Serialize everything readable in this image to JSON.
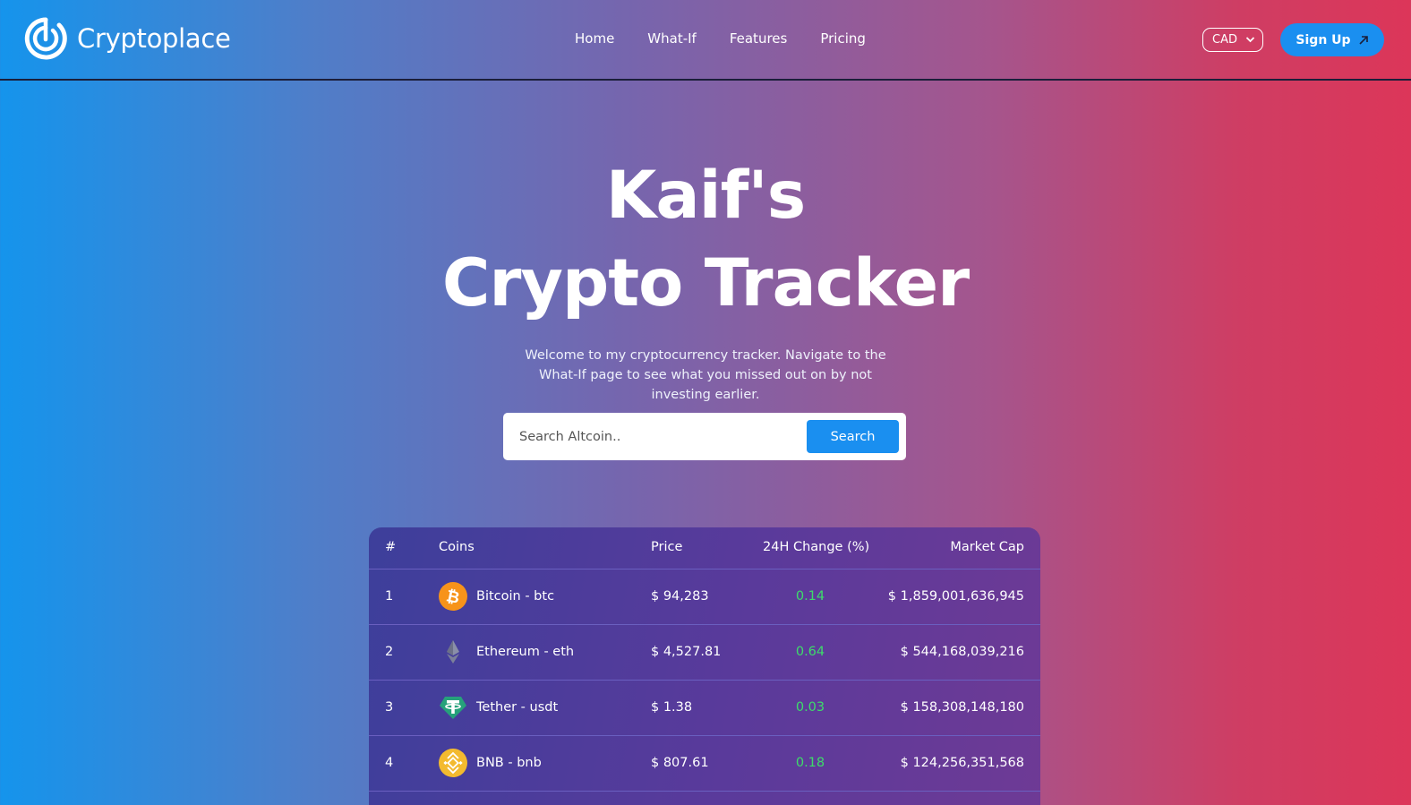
{
  "header": {
    "brand": "Cryptoplace",
    "nav": [
      "Home",
      "What-If",
      "Features",
      "Pricing"
    ],
    "currency": "CAD",
    "signup_label": "Sign Up"
  },
  "hero": {
    "title_line1": "Kaif's",
    "title_line2": "Crypto Tracker",
    "subtitle": "Welcome to my cryptocurrency tracker. Navigate to the What-If page to see what you missed out on by not investing earlier."
  },
  "search": {
    "placeholder": "Search Altcoin..",
    "button_label": "Search"
  },
  "table": {
    "columns": [
      "#",
      "Coins",
      "Price",
      "24H Change (%)",
      "Market Cap"
    ],
    "rows": [
      {
        "rank": "1",
        "coin": "Bitcoin - btc",
        "icon": "bitcoin-icon",
        "price": "$ 94,283",
        "change": "0.14",
        "cap": "$ 1,859,001,636,945"
      },
      {
        "rank": "2",
        "coin": "Ethereum - eth",
        "icon": "ethereum-icon",
        "price": "$ 4,527.81",
        "change": "0.64",
        "cap": "$ 544,168,039,216"
      },
      {
        "rank": "3",
        "coin": "Tether - usdt",
        "icon": "tether-icon",
        "price": "$ 1.38",
        "change": "0.03",
        "cap": "$ 158,308,148,180"
      },
      {
        "rank": "4",
        "coin": "BNB - bnb",
        "icon": "bnb-icon",
        "price": "$ 807.61",
        "change": "0.18",
        "cap": "$ 124,256,351,568"
      }
    ]
  },
  "colors": {
    "accent": "#1a8ff0",
    "positive": "#3ddc6a",
    "bitcoin": "#f7931a",
    "tether": "#26a17b",
    "bnb": "#f3ba2f"
  }
}
